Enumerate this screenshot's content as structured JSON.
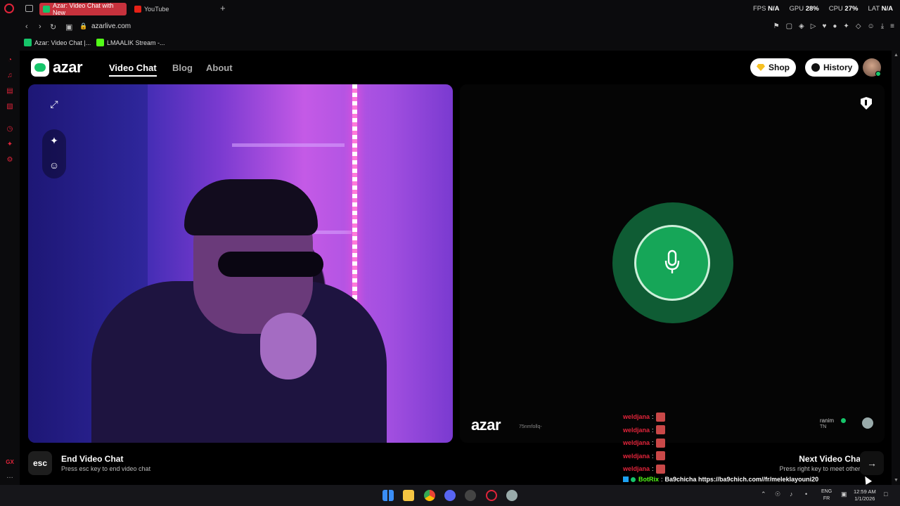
{
  "browser": {
    "tabs": [
      {
        "label": "Azar: Video Chat with New",
        "active": true
      },
      {
        "label": "YouTube",
        "active": false
      }
    ],
    "hud": {
      "fps_label": "FPS",
      "fps_value": "N/A",
      "gpu_label": "GPU",
      "gpu_value": "28%",
      "cpu_label": "CPU",
      "cpu_value": "27%",
      "lat_label": "LAT",
      "lat_value": "N/A"
    },
    "url": "azarlive.com",
    "bookmarks": [
      {
        "label": "Azar: Video Chat |..."
      },
      {
        "label": "LMAALIK Stream -..."
      }
    ]
  },
  "site": {
    "logo_text": "azar",
    "nav": [
      {
        "label": "Video Chat",
        "active": true
      },
      {
        "label": "Blog",
        "active": false
      },
      {
        "label": "About",
        "active": false
      }
    ],
    "shop_label": "Shop",
    "history_label": "History"
  },
  "peer": {
    "watermark": "azar",
    "id": "75nmfollq-",
    "name": "ranim",
    "country": "TN"
  },
  "controls": {
    "esc_key": "esc",
    "end_title": "End Video Chat",
    "end_sub": "Press esc key to end video chat",
    "next_title": "Next Video Chat",
    "next_sub": "Press right key to meet others"
  },
  "stream_chat": {
    "messages": [
      {
        "user": "weldjana",
        "sep": ":"
      },
      {
        "user": "weldjana",
        "sep": ":"
      },
      {
        "user": "weldjana",
        "sep": ":"
      },
      {
        "user": "weldjana",
        "sep": ":"
      },
      {
        "user": "weldjana",
        "sep": ":"
      }
    ],
    "bot": {
      "user": "BotRix",
      "sep": ":",
      "text": "Ba9chicha https://ba9chich.com//fr/meleklayouni20"
    }
  },
  "taskbar": {
    "lang_top": "ENG",
    "lang_bottom": "FR",
    "time": "12:59 AM",
    "date": "1/1/2026"
  },
  "colors": {
    "accent_green": "#16c56a",
    "opera_red": "#e0243a",
    "tab_active": "#c7323d"
  }
}
